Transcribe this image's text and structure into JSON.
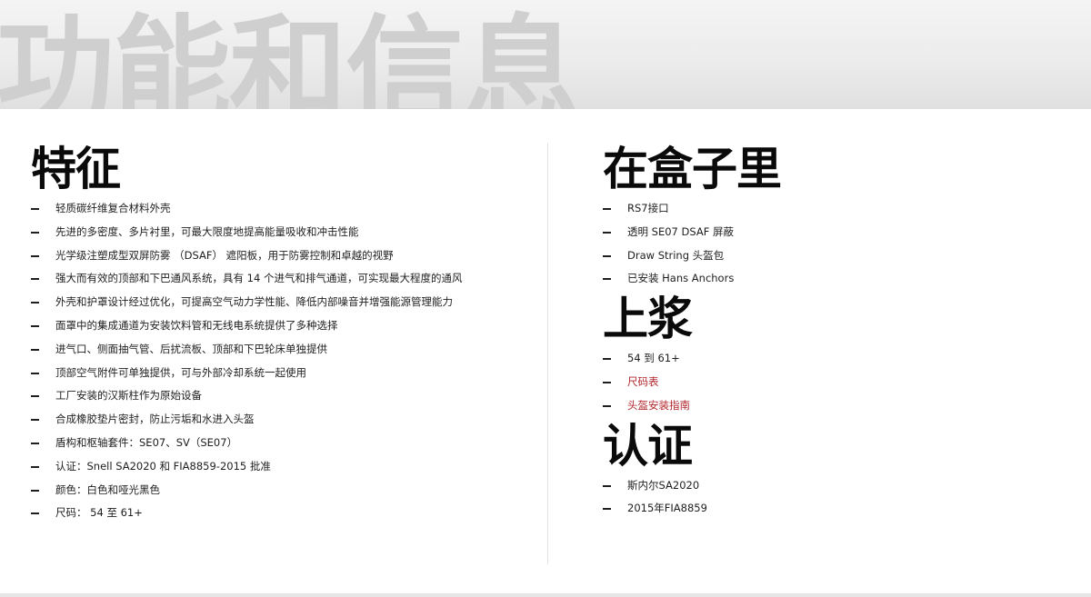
{
  "header": {
    "title": "功能和信息"
  },
  "features": {
    "title": "特征",
    "items": [
      "轻质碳纤维复合材料外壳",
      "先进的多密度、多片衬里，可最大限度地提高能量吸收和冲击性能",
      "光学级注塑成型双屏防雾 （DSAF） 遮阳板，用于防雾控制和卓越的视野",
      "强大而有效的顶部和下巴通风系统，具有 14 个进气和排气通道，可实现最大程度的通风",
      "外壳和护罩设计经过优化，可提高空气动力学性能、降低内部噪音并增强能源管理能力",
      "面罩中的集成通道为安装饮料管和无线电系统提供了多种选择",
      "进气口、侧面抽气管、后扰流板、顶部和下巴轮床单独提供",
      "顶部空气附件可单独提供，可与外部冷却系统一起使用",
      "工厂安装的汉斯柱作为原始设备",
      "合成橡胶垫片密封，防止污垢和水进入头盔",
      "盾构和枢轴套件：SE07、SV（SE07）",
      "认证：Snell SA2020 和 FIA8859-2015 批准",
      "颜色：白色和哑光黑色",
      "尺码： 54 至 61+"
    ]
  },
  "in_box": {
    "title": "在盒子里",
    "items": [
      "RS7接口",
      "透明 SE07 DSAF 屏蔽",
      "Draw String 头盔包",
      "已安装 Hans Anchors"
    ]
  },
  "sizing": {
    "title": "上浆",
    "range": "54 到 61+",
    "links": [
      "尺码表",
      "头盔安装指南"
    ]
  },
  "certification": {
    "title": "认证",
    "items": [
      "斯内尔SA2020",
      "2015年FIA8859"
    ]
  },
  "colors": {
    "link": "#b3262c",
    "watermark": "#cfcfcf",
    "text": "#1e1e1e"
  }
}
